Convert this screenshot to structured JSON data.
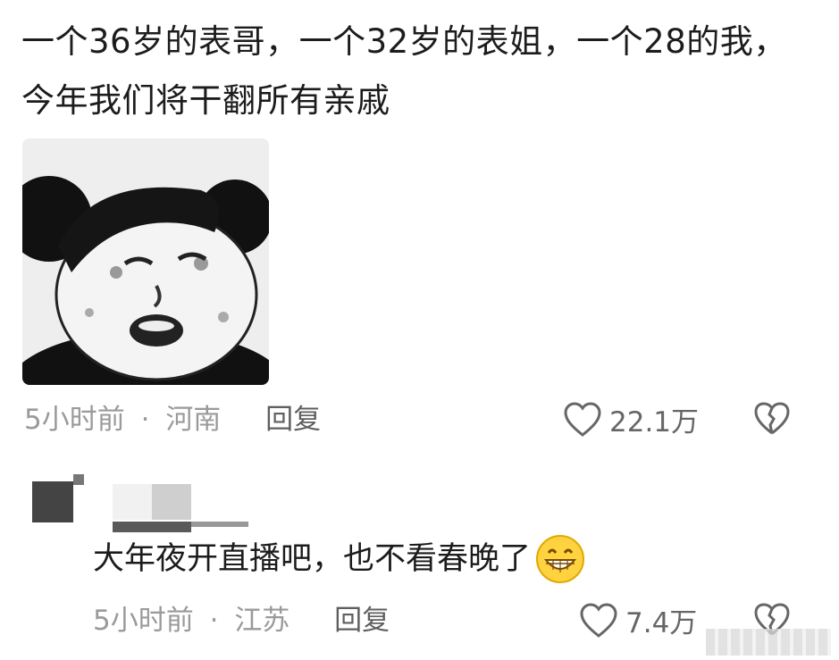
{
  "comment": {
    "text": "一个36岁的表哥，一个32岁的表姐，一个28的我，今年我们将干翻所有亲戚",
    "time": "5小时前",
    "location": "河南",
    "separator": "·",
    "reply_label": "回复",
    "likes": "22.1万",
    "image_icon": "panda-head-meme"
  },
  "reply": {
    "text": "大年夜开直播吧，也不看春晚了",
    "emoji": "grin-emoji",
    "time": "5小时前",
    "location": "江苏",
    "separator": "·",
    "reply_label": "回复",
    "likes": "7.4万"
  },
  "colors": {
    "meta_gray": "#9a9a9a",
    "text": "#1c1c1c",
    "icon_gray": "#666666"
  }
}
